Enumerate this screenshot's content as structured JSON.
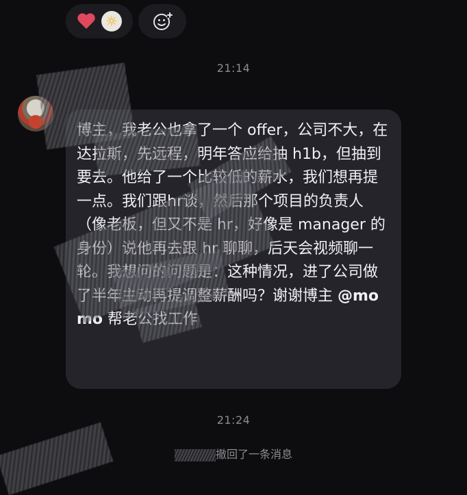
{
  "reactions": {
    "emojis": [
      "heart-emoji",
      "sun-emoji"
    ],
    "add_icon": "smiley-plus-icon"
  },
  "timestamps": {
    "first": "21:14",
    "second": "21:24"
  },
  "message": {
    "text": "博主，我老公也拿了一个 offer，公司不大，在达拉斯，先远程，明年答应给抽 h1b，但抽到要去。他给了一个比较低的薪水，我们想再提一点。我们跟hr谈，然后那个项目的负责人（像老板，但又不是 hr，好像是 manager 的身份）说他再去跟 hr 聊聊，后天会视频聊一轮。我想问的问题是：这种情况，进了公司做了半年主动再提调整薪酬吗？谢谢博主 ",
    "mention": "@momo",
    "suffix": " 帮老公找工作"
  },
  "recall": {
    "text": "撤回了一条消息"
  },
  "colors": {
    "background": "#0d0d0f",
    "bubble": "#24242a",
    "timestamp": "#8c8c92"
  }
}
